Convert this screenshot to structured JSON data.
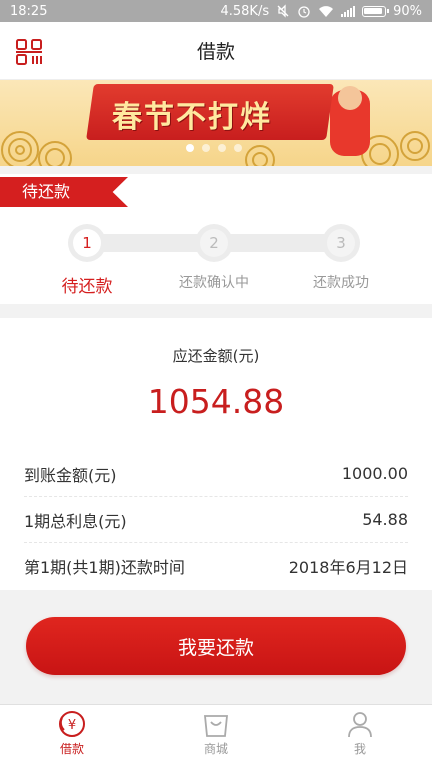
{
  "statusbar": {
    "time": "18:25",
    "speed": "4.58K/s",
    "battery": "90%"
  },
  "header": {
    "title": "借款",
    "qr_icon": "qr-code-icon"
  },
  "banner": {
    "text": "春节不打烊",
    "slides": 4,
    "active_slide": 0
  },
  "section_tag": "待还款",
  "steps": [
    {
      "num": "1",
      "label": "待还款",
      "active": true
    },
    {
      "num": "2",
      "label": "还款确认中",
      "active": false
    },
    {
      "num": "3",
      "label": "还款成功",
      "active": false
    }
  ],
  "repayment": {
    "title": "应还金额(元)",
    "amount": "1054.88",
    "rows": [
      {
        "label": "到账金额(元)",
        "value": "1000.00"
      },
      {
        "label": "1期总利息(元)",
        "value": "54.88"
      },
      {
        "label": "第1期(共1期)还款时间",
        "value": "2018年6月12日"
      }
    ]
  },
  "pay_button": "我要还款",
  "tabs": [
    {
      "label": "借款",
      "icon": "yen-circle-icon",
      "active": true
    },
    {
      "label": "商城",
      "icon": "shopping-bag-icon",
      "active": false
    },
    {
      "label": "我",
      "icon": "person-icon",
      "active": false
    }
  ],
  "colors": {
    "accent": "#c81e1e",
    "status_bar": "#a9a9a9"
  }
}
